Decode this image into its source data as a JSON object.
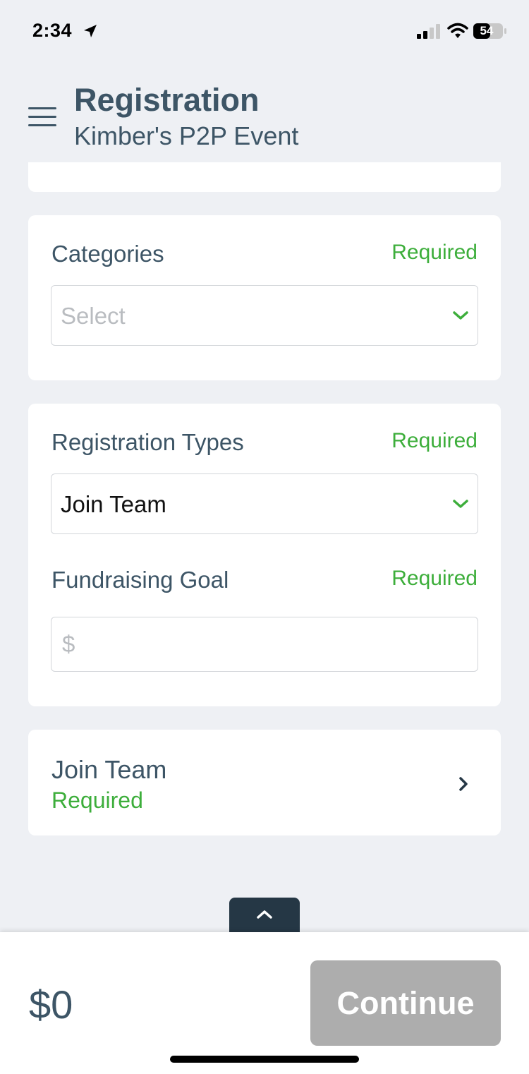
{
  "status_bar": {
    "time": "2:34",
    "battery": "54",
    "icons": [
      "location-arrow-icon",
      "signal-icon",
      "wifi-icon",
      "battery-icon"
    ]
  },
  "header": {
    "title": "Registration",
    "subtitle": "Kimber's P2P Event",
    "menu_icon": "hamburger-menu-icon"
  },
  "categories": {
    "label": "Categories",
    "required": "Required",
    "placeholder": "Select"
  },
  "registration_types": {
    "label": "Registration Types",
    "required": "Required",
    "selected": "Join Team"
  },
  "fundraising_goal": {
    "label": "Fundraising Goal",
    "required": "Required",
    "placeholder": "$"
  },
  "join_team": {
    "title": "Join Team",
    "required": "Required"
  },
  "footer": {
    "total": "$0",
    "continue_label": "Continue"
  },
  "colors": {
    "accent_green": "#3dae3b",
    "text_primary": "#3d5566",
    "button_disabled": "#adadad",
    "tab_dark": "#253745",
    "background": "#eef0f4"
  }
}
